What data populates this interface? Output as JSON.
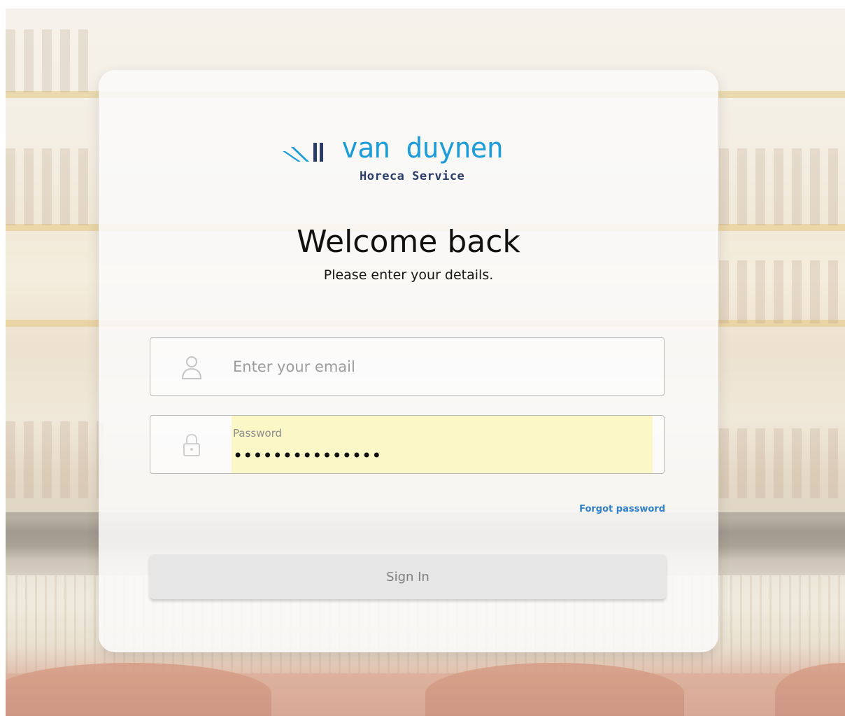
{
  "brand": {
    "name": "van duynen",
    "tagline": "Horeca Service",
    "mark_icon": "van-duynen-logo-mark",
    "name_color": "#1e9cd7",
    "tagline_color": "#2a3d67"
  },
  "login": {
    "title": "Welcome back",
    "subtitle": "Please enter your details.",
    "email": {
      "placeholder": "Enter your email",
      "value": "",
      "icon": "user-icon"
    },
    "password": {
      "label": "Password",
      "masked_value": "•••••••••••••••",
      "icon": "lock-icon",
      "autofill_color": "#fbf7c7"
    },
    "forgot_password": "Forgot password",
    "sign_in": "Sign In",
    "link_color": "#2f7fc5"
  }
}
